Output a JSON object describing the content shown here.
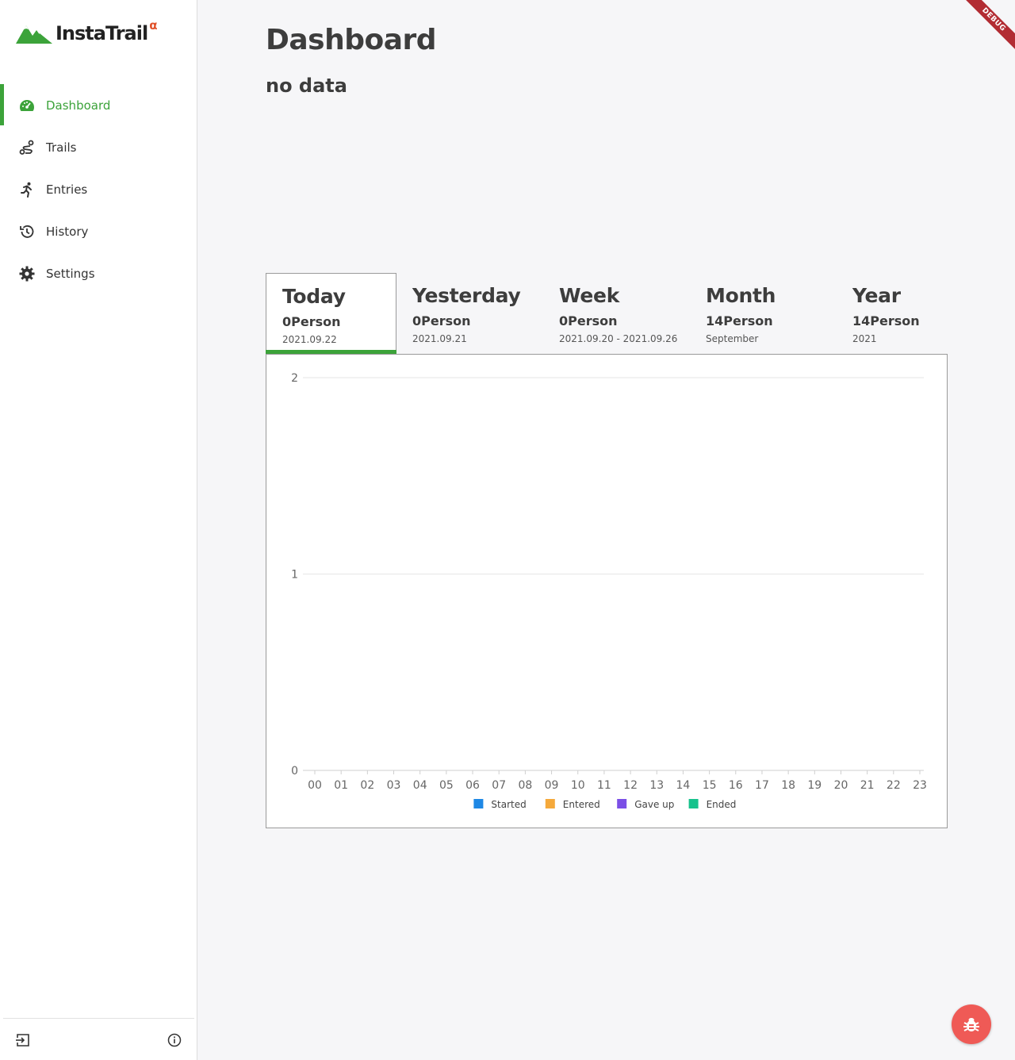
{
  "app": {
    "logo_text": "InstaTrail",
    "logo_superscript": "α",
    "brand_color": "#3ca33a",
    "alpha_color": "#e0512a"
  },
  "sidebar": {
    "items": [
      {
        "label": "Dashboard",
        "icon": "speedometer-icon",
        "active": true
      },
      {
        "label": "Trails",
        "icon": "route-icon",
        "active": false
      },
      {
        "label": "Entries",
        "icon": "runner-icon",
        "active": false
      },
      {
        "label": "History",
        "icon": "history-icon",
        "active": false
      },
      {
        "label": "Settings",
        "icon": "gear-icon",
        "active": false
      }
    ],
    "footer": {
      "logout_icon": "logout-icon",
      "info_icon": "info-icon"
    }
  },
  "main": {
    "title": "Dashboard",
    "status": "no data",
    "tabs": [
      {
        "title": "Today",
        "count": "0Person",
        "sub": "2021.09.22",
        "active": true
      },
      {
        "title": "Yesterday",
        "count": "0Person",
        "sub": "2021.09.21",
        "active": false
      },
      {
        "title": "Week",
        "count": "0Person",
        "sub": "2021.09.20 - 2021.09.26",
        "active": false
      },
      {
        "title": "Month",
        "count": "14Person",
        "sub": "September",
        "active": false
      },
      {
        "title": "Year",
        "count": "14Person",
        "sub": "2021",
        "active": false
      }
    ]
  },
  "chart_data": {
    "type": "bar",
    "title": "",
    "xlabel": "",
    "ylabel": "",
    "categories": [
      "00",
      "01",
      "02",
      "03",
      "04",
      "05",
      "06",
      "07",
      "08",
      "09",
      "10",
      "11",
      "12",
      "13",
      "14",
      "15",
      "16",
      "17",
      "18",
      "19",
      "20",
      "21",
      "22",
      "23"
    ],
    "yticks": [
      "0",
      "1",
      "2"
    ],
    "ylim": [
      0,
      2
    ],
    "grid": true,
    "legend_position": "bottom",
    "series": [
      {
        "name": "Started",
        "color": "#1e88e5",
        "values": [
          0,
          0,
          0,
          0,
          0,
          0,
          0,
          0,
          0,
          0,
          0,
          0,
          0,
          0,
          0,
          0,
          0,
          0,
          0,
          0,
          0,
          0,
          0,
          0
        ]
      },
      {
        "name": "Entered",
        "color": "#f5a93b",
        "values": [
          0,
          0,
          0,
          0,
          0,
          0,
          0,
          0,
          0,
          0,
          0,
          0,
          0,
          0,
          0,
          0,
          0,
          0,
          0,
          0,
          0,
          0,
          0,
          0
        ]
      },
      {
        "name": "Gave up",
        "color": "#7b4fe6",
        "values": [
          0,
          0,
          0,
          0,
          0,
          0,
          0,
          0,
          0,
          0,
          0,
          0,
          0,
          0,
          0,
          0,
          0,
          0,
          0,
          0,
          0,
          0,
          0,
          0
        ]
      },
      {
        "name": "Ended",
        "color": "#17c28c",
        "values": [
          0,
          0,
          0,
          0,
          0,
          0,
          0,
          0,
          0,
          0,
          0,
          0,
          0,
          0,
          0,
          0,
          0,
          0,
          0,
          0,
          0,
          0,
          0,
          0
        ]
      }
    ]
  },
  "debug": {
    "ribbon_text": "DEBUG",
    "fab_icon": "bug-icon",
    "fab_color": "#ef5a56"
  }
}
